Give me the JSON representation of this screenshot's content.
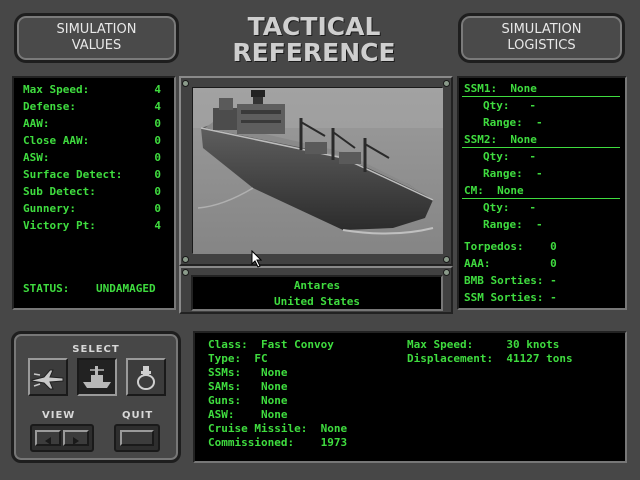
{
  "header": {
    "left_button": "SIMULATION\nVALUES",
    "title": "TACTICAL\nREFERENCE",
    "right_button": "SIMULATION\nLOGISTICS"
  },
  "sim_values": [
    {
      "label": "Max Speed:",
      "value": "4"
    },
    {
      "label": "Defense:",
      "value": "4"
    },
    {
      "label": "AAW:",
      "value": "0"
    },
    {
      "label": "Close AAW:",
      "value": "0"
    },
    {
      "label": "ASW:",
      "value": "0"
    },
    {
      "label": "Surface Detect:",
      "value": "0"
    },
    {
      "label": "Sub Detect:",
      "value": "0"
    },
    {
      "label": "Gunnery:",
      "value": "0"
    },
    {
      "label": "Victory Pt:",
      "value": "4"
    }
  ],
  "status": {
    "label": "STATUS:",
    "value": "UNDAMAGED"
  },
  "ship": {
    "name": "Antares",
    "nation": "United States"
  },
  "logistics": {
    "ssm1": "SSM1:  None",
    "ssm1_qty": "Qty:   -",
    "ssm1_range": "Range:  -",
    "ssm2": "SSM2:  None",
    "ssm2_qty": "Qty:   -",
    "ssm2_range": "Range:  -",
    "cm": "CM:  None",
    "cm_qty": "Qty:   -",
    "cm_range": "Range:  -",
    "torpedos": "Torpedos:    0",
    "aaa": "AAA:         0",
    "bmb": "BMB Sorties: -",
    "ssm_sorties": "SSM Sorties: -"
  },
  "controls": {
    "select": "SELECT",
    "view": "VIEW",
    "quit": "QUIT"
  },
  "details": {
    "lines": [
      "Class:  Fast Convoy",
      "Type:  FC",
      "SSMs:   None",
      "SAMs:   None",
      "Guns:   None",
      "ASW:    None",
      "Cruise Missile:  None",
      "Commissioned:    1973"
    ],
    "max_speed": "Max Speed:     30 knots",
    "displacement": "Displacement:  41127 tons"
  },
  "icons": [
    "aircraft-icon",
    "ship-icon",
    "submarine-icon",
    "arrow-left-icon",
    "arrow-right-icon"
  ]
}
